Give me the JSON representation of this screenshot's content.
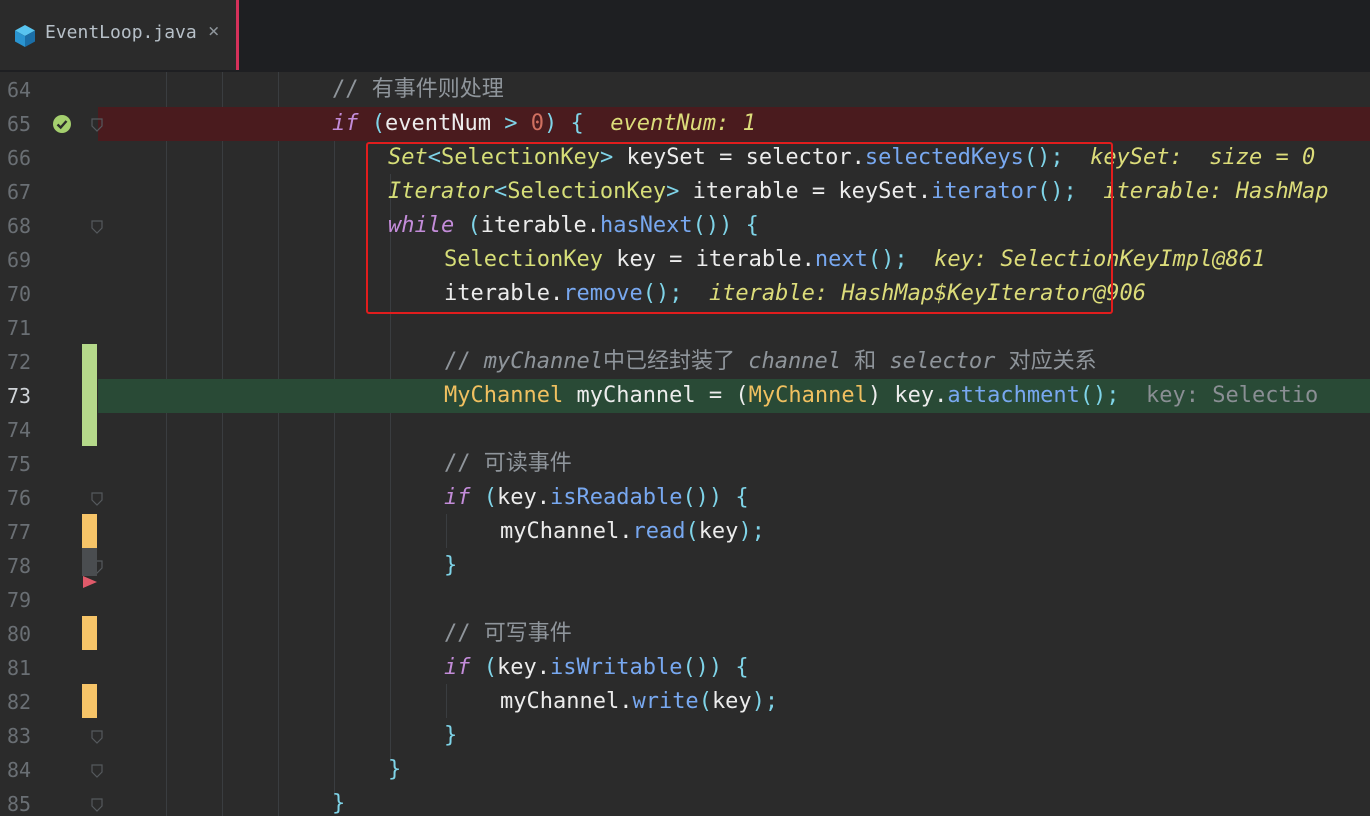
{
  "tab": {
    "title": "EventLoop.java",
    "close": "×"
  },
  "lines": [
    {
      "n": "64",
      "parts": [
        {
          "t": "// 有事件则处理",
          "c": "cm"
        }
      ]
    },
    {
      "n": "65",
      "parts": [
        {
          "t": "if",
          "c": "kw"
        },
        {
          "t": " (",
          "c": "op"
        },
        {
          "t": "eventNum",
          "c": "id"
        },
        {
          "t": " > ",
          "c": "op"
        },
        {
          "t": "0",
          "c": "num"
        },
        {
          "t": ") {",
          "c": "op"
        },
        {
          "t": "  eventNum: 1",
          "c": "hint"
        }
      ]
    },
    {
      "n": "66",
      "parts": [
        {
          "t": "Set",
          "c": "tyi"
        },
        {
          "t": "<",
          "c": "op"
        },
        {
          "t": "SelectionKey",
          "c": "ty2"
        },
        {
          "t": "> ",
          "c": "op"
        },
        {
          "t": "keySet = selector.",
          "c": "id"
        },
        {
          "t": "selectedKeys",
          "c": "mt"
        },
        {
          "t": "();",
          "c": "op"
        },
        {
          "t": "  keySet:  size = 0",
          "c": "hint"
        }
      ]
    },
    {
      "n": "67",
      "parts": [
        {
          "t": "Iterator",
          "c": "tyi"
        },
        {
          "t": "<",
          "c": "op"
        },
        {
          "t": "SelectionKey",
          "c": "ty2"
        },
        {
          "t": "> ",
          "c": "op"
        },
        {
          "t": "iterable = keySet.",
          "c": "id"
        },
        {
          "t": "iterator",
          "c": "mt"
        },
        {
          "t": "();",
          "c": "op"
        },
        {
          "t": "  iterable: HashMap",
          "c": "hint"
        }
      ]
    },
    {
      "n": "68",
      "parts": [
        {
          "t": "while",
          "c": "kw"
        },
        {
          "t": " (",
          "c": "op"
        },
        {
          "t": "iterable.",
          "c": "id"
        },
        {
          "t": "hasNext",
          "c": "mt"
        },
        {
          "t": "()) {",
          "c": "op"
        }
      ]
    },
    {
      "n": "69",
      "parts": [
        {
          "t": "SelectionKey",
          "c": "ty2"
        },
        {
          "t": " key = iterable.",
          "c": "id"
        },
        {
          "t": "next",
          "c": "mt"
        },
        {
          "t": "();",
          "c": "op"
        },
        {
          "t": "  key: SelectionKeyImpl@861",
          "c": "hint"
        }
      ]
    },
    {
      "n": "70",
      "parts": [
        {
          "t": "iterable.",
          "c": "id"
        },
        {
          "t": "remove",
          "c": "mt"
        },
        {
          "t": "();",
          "c": "op"
        },
        {
          "t": "  iterable: HashMap$KeyIterator@906",
          "c": "hint"
        }
      ]
    },
    {
      "n": "71",
      "parts": []
    },
    {
      "n": "72",
      "parts": [
        {
          "t": "// ",
          "c": "cm"
        },
        {
          "t": "myChannel",
          "c": "cmi"
        },
        {
          "t": "中已经封装了 ",
          "c": "cm"
        },
        {
          "t": "channel",
          "c": "cmi"
        },
        {
          "t": " 和 ",
          "c": "cm"
        },
        {
          "t": "selector",
          "c": "cmi"
        },
        {
          "t": " 对应关系",
          "c": "cm"
        }
      ]
    },
    {
      "n": "73",
      "parts": [
        {
          "t": "MyChannel",
          "c": "cty"
        },
        {
          "t": " myChannel = (",
          "c": "id"
        },
        {
          "t": "MyChannel",
          "c": "cty"
        },
        {
          "t": ") key.",
          "c": "id"
        },
        {
          "t": "attachment",
          "c": "mt"
        },
        {
          "t": "();",
          "c": "op"
        },
        {
          "t": "  key: Selectio",
          "c": "hint-gray"
        }
      ]
    },
    {
      "n": "74",
      "parts": []
    },
    {
      "n": "75",
      "parts": [
        {
          "t": "// 可读事件",
          "c": "cm"
        }
      ]
    },
    {
      "n": "76",
      "parts": [
        {
          "t": "if",
          "c": "kw"
        },
        {
          "t": " (",
          "c": "op"
        },
        {
          "t": "key.",
          "c": "id"
        },
        {
          "t": "isReadable",
          "c": "mt"
        },
        {
          "t": "()) {",
          "c": "op"
        }
      ]
    },
    {
      "n": "77",
      "parts": [
        {
          "t": "myChannel.",
          "c": "id"
        },
        {
          "t": "read",
          "c": "mt"
        },
        {
          "t": "(",
          "c": "op"
        },
        {
          "t": "key",
          "c": "id"
        },
        {
          "t": ");",
          "c": "op"
        }
      ]
    },
    {
      "n": "78",
      "parts": [
        {
          "t": "}",
          "c": "op"
        }
      ]
    },
    {
      "n": "79",
      "parts": []
    },
    {
      "n": "80",
      "parts": [
        {
          "t": "// 可写事件",
          "c": "cm"
        }
      ]
    },
    {
      "n": "81",
      "parts": [
        {
          "t": "if",
          "c": "kw"
        },
        {
          "t": " (",
          "c": "op"
        },
        {
          "t": "key.",
          "c": "id"
        },
        {
          "t": "isWritable",
          "c": "mt"
        },
        {
          "t": "()) {",
          "c": "op"
        }
      ]
    },
    {
      "n": "82",
      "parts": [
        {
          "t": "myChannel.",
          "c": "id"
        },
        {
          "t": "write",
          "c": "mt"
        },
        {
          "t": "(",
          "c": "op"
        },
        {
          "t": "key",
          "c": "id"
        },
        {
          "t": ");",
          "c": "op"
        }
      ]
    },
    {
      "n": "83",
      "parts": [
        {
          "t": "}",
          "c": "op"
        }
      ]
    },
    {
      "n": "84",
      "parts": [
        {
          "t": "}",
          "c": "op"
        }
      ]
    },
    {
      "n": "85",
      "parts": [
        {
          "t": "}",
          "c": "op"
        }
      ]
    }
  ],
  "breakpoint_line": "65",
  "execution_line": "73",
  "icons": {
    "tab_file": "java-class-icon",
    "breakpoint": "verified-breakpoint-icon",
    "execution_pointer": "execution-pointer-icon"
  },
  "colors": {
    "background": "#2b2b2b",
    "breakpoint_highlight": "#4a1b1e",
    "execution_highlight": "#294a36",
    "annotation_box": "#e11d1d"
  }
}
